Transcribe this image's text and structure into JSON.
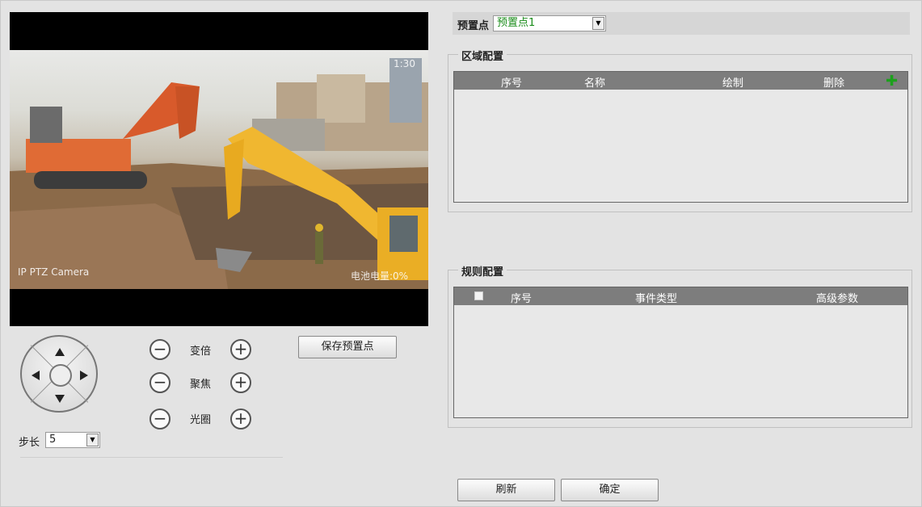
{
  "video": {
    "camera_label": "IP PTZ Camera",
    "battery_label": "电池电量:0%",
    "time_fragment": "1:30"
  },
  "ptz": {
    "zoom_label": "变倍",
    "focus_label": "聚焦",
    "iris_label": "光圈",
    "minus_glyph": "−",
    "plus_glyph": "+",
    "save_preset_label": "保存预置点",
    "step_label": "步长",
    "step_value": "5",
    "dropdown_glyph": "▼"
  },
  "preset": {
    "label": "预置点",
    "value": "预置点1",
    "value_color": "#1a8c1a"
  },
  "region_config": {
    "legend": "区域配置",
    "columns": [
      "序号",
      "名称",
      "绘制",
      "删除"
    ],
    "add_icon": "✚"
  },
  "rule_config": {
    "legend": "规则配置",
    "columns": [
      "序号",
      "事件类型",
      "高级参数"
    ]
  },
  "footer": {
    "refresh_label": "刷新",
    "ok_label": "确定"
  }
}
